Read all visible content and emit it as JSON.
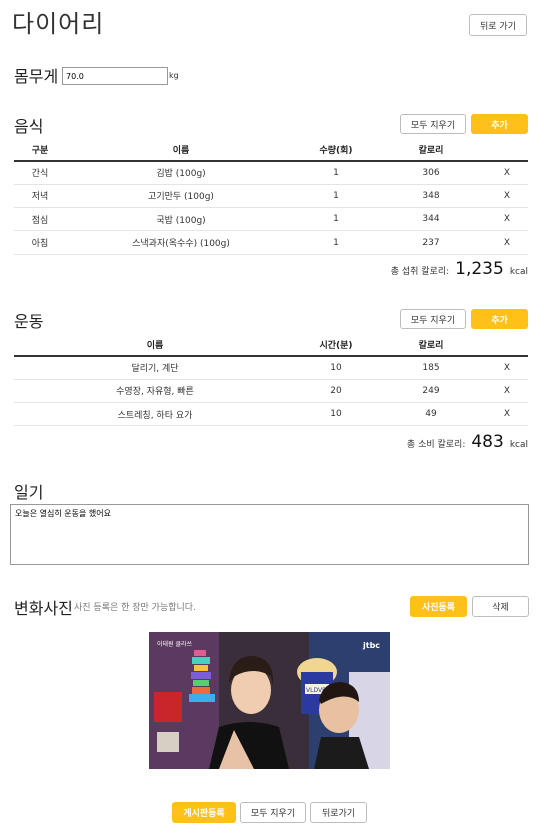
{
  "header": {
    "title": "다이어리",
    "back_label": "뒤로 가기"
  },
  "weight": {
    "label": "몸무게",
    "value": "70.0",
    "unit": "kg"
  },
  "food": {
    "title": "음식",
    "clear_label": "모두 지우기",
    "add_label": "추가",
    "columns": [
      "구분",
      "이름",
      "수량(회)",
      "칼로리"
    ],
    "rows": [
      {
        "type": "간식",
        "name": "김밥 (100g)",
        "qty": "1",
        "kcal": "306",
        "delete": "X"
      },
      {
        "type": "저녁",
        "name": "고기만두 (100g)",
        "qty": "1",
        "kcal": "348",
        "delete": "X"
      },
      {
        "type": "점심",
        "name": "국밥 (100g)",
        "qty": "1",
        "kcal": "344",
        "delete": "X"
      },
      {
        "type": "아침",
        "name": "스낵과자(옥수수) (100g)",
        "qty": "1",
        "kcal": "237",
        "delete": "X"
      }
    ],
    "total_label": "총 섭취 칼로리:",
    "total_value": "1,235",
    "total_unit": "kcal"
  },
  "exercise": {
    "title": "운동",
    "clear_label": "모두 지우기",
    "add_label": "추가",
    "columns": [
      "이름",
      "시간(분)",
      "칼로리"
    ],
    "rows": [
      {
        "name": "달리기, 계단",
        "time": "10",
        "kcal": "185",
        "delete": "X"
      },
      {
        "name": "수영장, 자유형, 빠른",
        "time": "20",
        "kcal": "249",
        "delete": "X"
      },
      {
        "name": "스트레칭, 하타 요가",
        "time": "10",
        "kcal": "49",
        "delete": "X"
      }
    ],
    "total_label": "총 소비 칼로리:",
    "total_value": "483",
    "total_unit": "kcal"
  },
  "diary": {
    "title": "일기",
    "content": "오늘은 열심히 운동을 했어요"
  },
  "photo": {
    "title": "변화사진",
    "hint": "사진 등록은 한 장만 가능합니다.",
    "upload_label": "사진등록",
    "delete_label": "삭제",
    "overlay_left": "이태원 클라쓰",
    "overlay_right": "jtbc",
    "sign_text": "VLDVRY"
  },
  "footer": {
    "submit_label": "게시판등록",
    "clear_label": "모두 지우기",
    "back_label": "뒤로가기"
  },
  "colors": {
    "accent": "#ffc117"
  }
}
